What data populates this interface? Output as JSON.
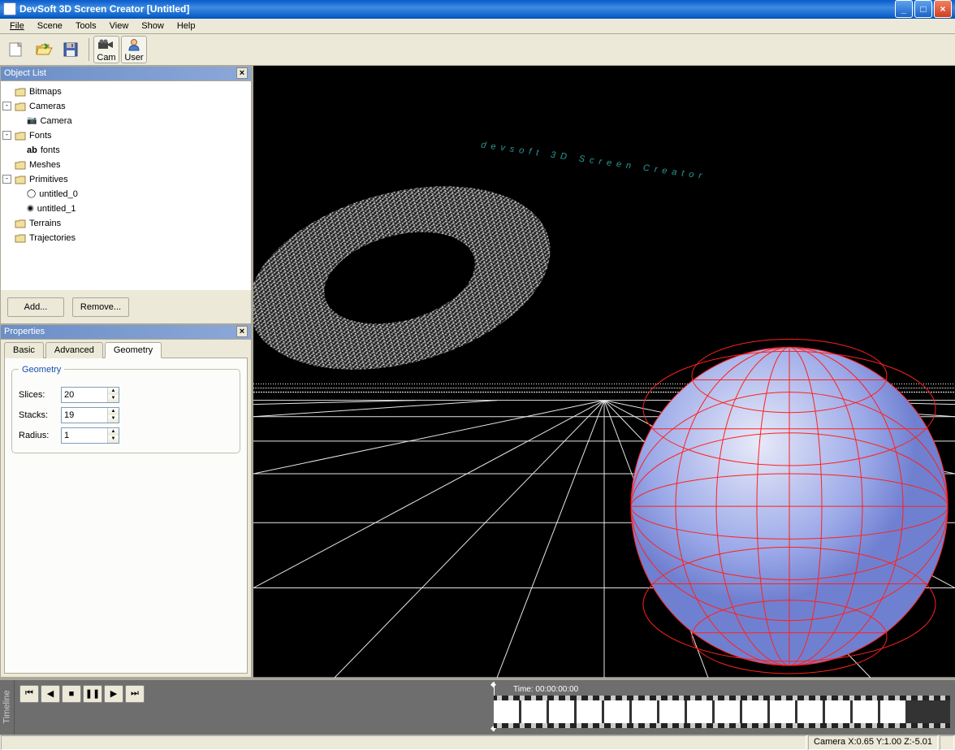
{
  "title": "DevSoft 3D Screen Creator [Untitled]",
  "menu": [
    "File",
    "Scene",
    "Tools",
    "View",
    "Show",
    "Help"
  ],
  "toolbar": {
    "cam": "Cam",
    "user": "User"
  },
  "panels": {
    "objectList": "Object List",
    "properties": "Properties",
    "timeline": "Timeline"
  },
  "tree": {
    "bitmaps": "Bitmaps",
    "cameras": "Cameras",
    "camera": "Camera",
    "fonts": "Fonts",
    "fontsLeaf": "fonts",
    "meshes": "Meshes",
    "primitives": "Primitives",
    "p0": "untitled_0",
    "p1": "untitled_1",
    "terrains": "Terrains",
    "trajectories": "Trajectories"
  },
  "buttons": {
    "add": "Add...",
    "remove": "Remove..."
  },
  "tabs": {
    "basic": "Basic",
    "advanced": "Advanced",
    "geometry": "Geometry"
  },
  "geometry": {
    "legend": "Geometry",
    "slicesLabel": "Slices:",
    "slices": "20",
    "stacksLabel": "Stacks:",
    "stacks": "19",
    "radiusLabel": "Radius:",
    "radius": "1"
  },
  "scene": {
    "text": "devsoft 3D Screen Creator"
  },
  "timeline": {
    "time": "Time: 00:00:00:00"
  },
  "status": {
    "camera": "Camera X:0.65 Y:1.00 Z:-5.01"
  }
}
